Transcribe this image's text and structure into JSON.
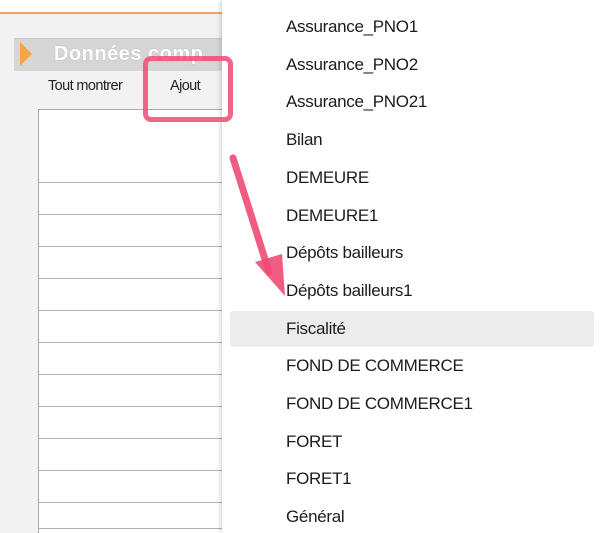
{
  "panel": {
    "title": "Données comp",
    "toolbar": {
      "show_all": "Tout montrer",
      "add": "Ajout"
    },
    "table_row_count": 13
  },
  "menu": {
    "hovered_index": 8,
    "items": [
      {
        "label": "Assurance_PNO1"
      },
      {
        "label": "Assurance_PNO2"
      },
      {
        "label": "Assurance_PNO21"
      },
      {
        "label": "Bilan"
      },
      {
        "label": "DEMEURE"
      },
      {
        "label": "DEMEURE1"
      },
      {
        "label": "Dépôts bailleurs"
      },
      {
        "label": "Dépôts bailleurs1"
      },
      {
        "label": "Fiscalité"
      },
      {
        "label": "FOND DE COMMERCE"
      },
      {
        "label": "FOND DE COMMERCE1"
      },
      {
        "label": "FORET"
      },
      {
        "label": "FORET1"
      },
      {
        "label": "Général"
      }
    ]
  },
  "colors": {
    "annotation": "#f04a73",
    "header_arrow": "#f5a442",
    "header_bg": "#d6d6d6",
    "hover_bg": "#ececec"
  }
}
